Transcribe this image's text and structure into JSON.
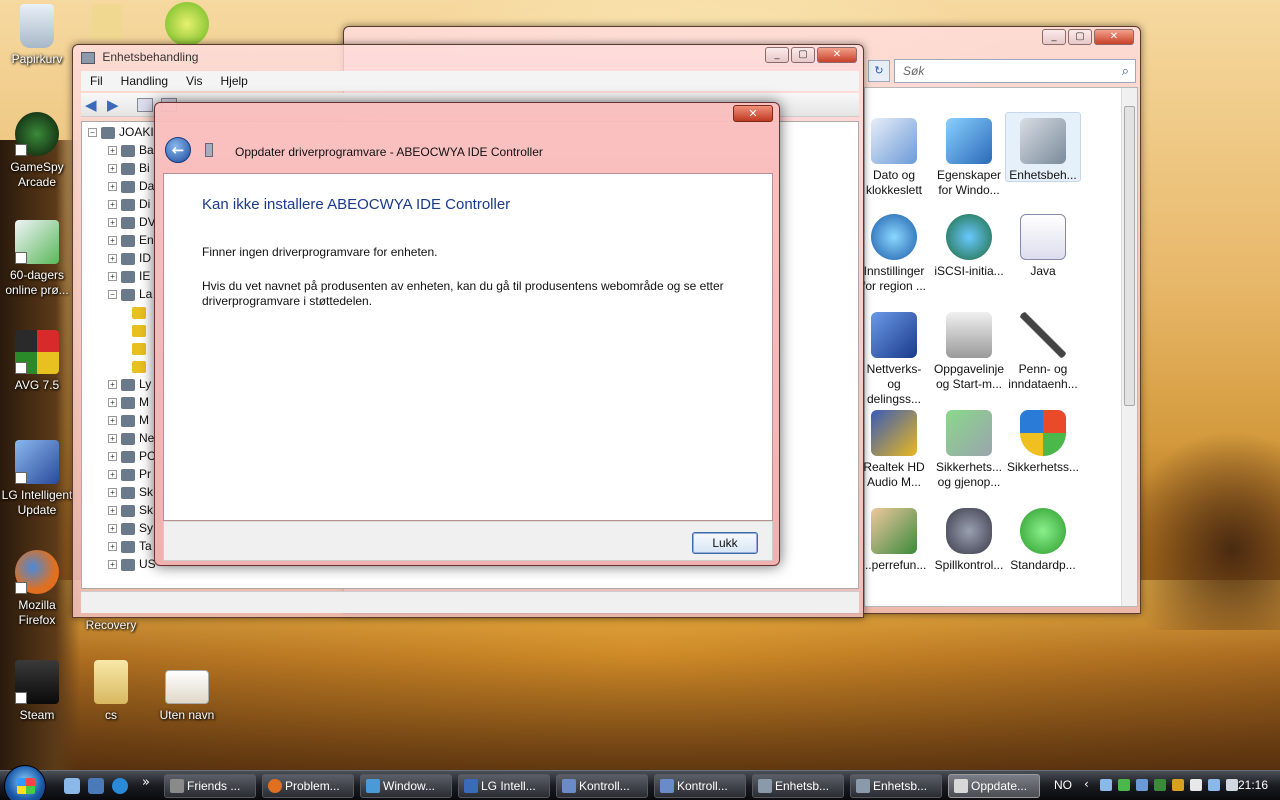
{
  "desktop": {
    "icons": [
      {
        "label": "Papirkurv",
        "color": "#c8d8e8"
      },
      {
        "label": "GameSpy Arcade",
        "color": "#1a3a1a"
      },
      {
        "label": "60-dagers online prø...",
        "color": "#e8f0f8"
      },
      {
        "label": "AVG 7.5",
        "color": "#c8a020"
      },
      {
        "label": "LG Intelligent Update",
        "color": "#3a6ab8"
      },
      {
        "label": "Mozilla Firefox",
        "color": "#e07020"
      },
      {
        "label": "Steam",
        "color": "#1a1a1a"
      },
      {
        "label": "cs",
        "color": "#f0d890"
      },
      {
        "label": "Uten navn",
        "color": "#f0f0e8"
      },
      {
        "label": "Recovery",
        "color": "#f0d890"
      }
    ]
  },
  "control_panel": {
    "search_placeholder": "Søk",
    "items": [
      {
        "label": "Dato og klokkeslett",
        "color": "#6a9ad8"
      },
      {
        "label": "Egenskaper for Windo...",
        "color": "#3a8ad8"
      },
      {
        "label": "Enhetsbeh...",
        "color": "#8a9aaa"
      },
      {
        "label": "Innstillinger for region ...",
        "color": "#2a7ac8"
      },
      {
        "label": "iSCSI-initia...",
        "color": "#2a8a3a"
      },
      {
        "label": "Java",
        "color": "#e8e8f0"
      },
      {
        "label": "Nettverks- og delingss...",
        "color": "#2a5ab8"
      },
      {
        "label": "Oppgavelinje og Start-m...",
        "color": "#d8d8d8"
      },
      {
        "label": "Penn- og inndataenh...",
        "color": "#6a6a6a"
      },
      {
        "label": "Realtek HD Audio M...",
        "color": "#2a4a9a"
      },
      {
        "label": "Sikkerhets... og gjenop...",
        "color": "#4aa84a"
      },
      {
        "label": "Sikkerhetss...",
        "color": "#e84a2a"
      },
      {
        "label": "...perrefun...",
        "color": "#3a8a3a"
      },
      {
        "label": "Spillkontrol...",
        "color": "#5a5a6a"
      },
      {
        "label": "Standardp...",
        "color": "#3ab83a"
      }
    ]
  },
  "device_manager": {
    "title": "Enhetsbehandling",
    "menu": [
      "Fil",
      "Handling",
      "Vis",
      "Hjelp"
    ],
    "root": "JOAKI",
    "nodes": [
      "Ba",
      "Bi",
      "Da",
      "Di",
      "DV",
      "En",
      "ID",
      "IE",
      "La",
      "Ly",
      "M",
      "M",
      "Ne",
      "PC",
      "Pr",
      "Sk",
      "Sk",
      "Sy",
      "Ta",
      "US"
    ]
  },
  "dialog": {
    "title": "Oppdater driverprogramvare - ABEOCWYA IDE Controller",
    "heading": "Kan ikke installere ABEOCWYA IDE Controller",
    "para1": "Finner ingen driverprogramvare for enheten.",
    "para2": "Hvis du vet navnet på produsenten av enheten, kan du gå til produsentens webområde og se etter driverprogramvare i støttedelen.",
    "close_label": "Lukk"
  },
  "taskbar": {
    "overflow": "»",
    "buttons": [
      {
        "label": "Friends ...",
        "color": "#8a8a8a"
      },
      {
        "label": "Problem...",
        "color": "#e07020"
      },
      {
        "label": "Window...",
        "color": "#4a9ad8"
      },
      {
        "label": "LG Intell...",
        "color": "#3a6ab8"
      },
      {
        "label": "Kontroll...",
        "color": "#6a8ac8"
      },
      {
        "label": "Kontroll...",
        "color": "#6a8ac8"
      },
      {
        "label": "Enhetsb...",
        "color": "#8a9aaa"
      },
      {
        "label": "Enhetsb...",
        "color": "#8a9aaa"
      },
      {
        "label": "Oppdate...",
        "color": "#d8d8d8"
      }
    ],
    "language": "NO",
    "clock": "21:16"
  }
}
